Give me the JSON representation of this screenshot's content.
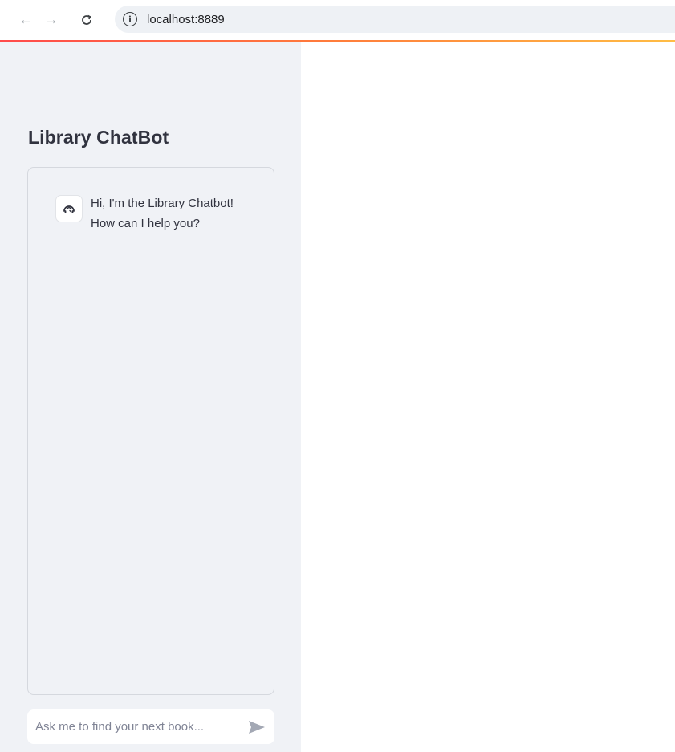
{
  "browser": {
    "url": "localhost:8889",
    "icons": {
      "back": "arrow-left-icon",
      "forward": "arrow-right-icon",
      "reload": "reload-icon",
      "site_info": "info-icon"
    }
  },
  "sidebar": {
    "title": "Library ChatBot",
    "messages": [
      {
        "role": "assistant",
        "avatar": "bot-avatar-icon",
        "text": "Hi, I'm the Library Chatbot! How can I help you?"
      }
    ],
    "chat_input": {
      "value": "",
      "placeholder": "Ask me to find your next book...",
      "send_icon": "send-icon"
    }
  },
  "colors": {
    "sidebar_bg": "#f0f2f6",
    "accent_start": "#ff4b4b",
    "accent_end": "#ffbd45",
    "text": "#31333f"
  }
}
